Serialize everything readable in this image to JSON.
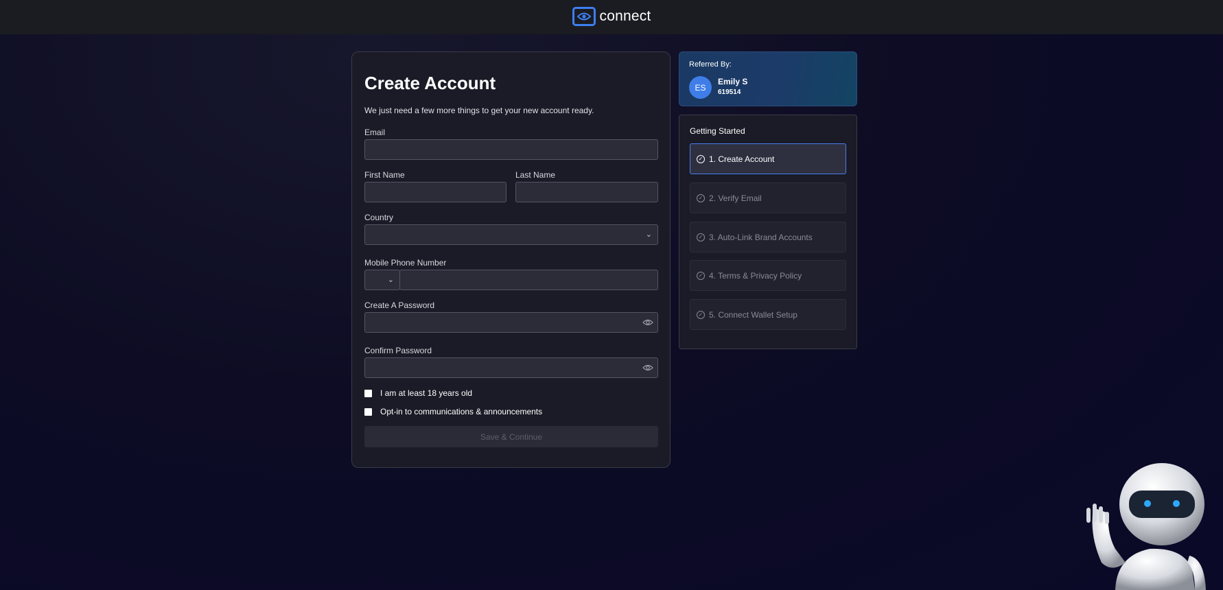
{
  "header": {
    "logo_text": "connect"
  },
  "form": {
    "title": "Create Account",
    "subtitle": "We just need a few more things to get your new account ready.",
    "email_label": "Email",
    "email_value": "",
    "first_name_label": "First Name",
    "first_name_value": "",
    "last_name_label": "Last Name",
    "last_name_value": "",
    "country_label": "Country",
    "country_value": "",
    "phone_label": "Mobile Phone Number",
    "phone_value": "",
    "password_label": "Create A Password",
    "password_value": "",
    "confirm_label": "Confirm Password",
    "confirm_value": "",
    "age_check_label": "I am at least 18 years old",
    "age_checked": false,
    "optin_label": "Opt-in to communications & announcements",
    "optin_checked": false,
    "save_label": "Save & Continue"
  },
  "referral": {
    "label": "Referred By:",
    "initials": "ES",
    "name": "Emily S",
    "code": "619514"
  },
  "steps": {
    "title": "Getting Started",
    "items": [
      {
        "label": "1. Create Account",
        "active": true
      },
      {
        "label": "2. Verify Email",
        "active": false
      },
      {
        "label": "3. Auto-Link Brand Accounts",
        "active": false
      },
      {
        "label": "4. Terms & Privacy Policy",
        "active": false
      },
      {
        "label": "5. Connect Wallet Setup",
        "active": false
      }
    ]
  },
  "colors": {
    "accent": "#3d7ff2",
    "background": "#0d0c24",
    "card": "#1a1b26",
    "avatar": "#3f7ee8"
  },
  "icons": {
    "logo": "eye-logo-icon",
    "select": "chevron-down-icon",
    "password_toggle": "eye-icon",
    "step": "check-circle-icon",
    "mascot": "robot-mascot"
  }
}
